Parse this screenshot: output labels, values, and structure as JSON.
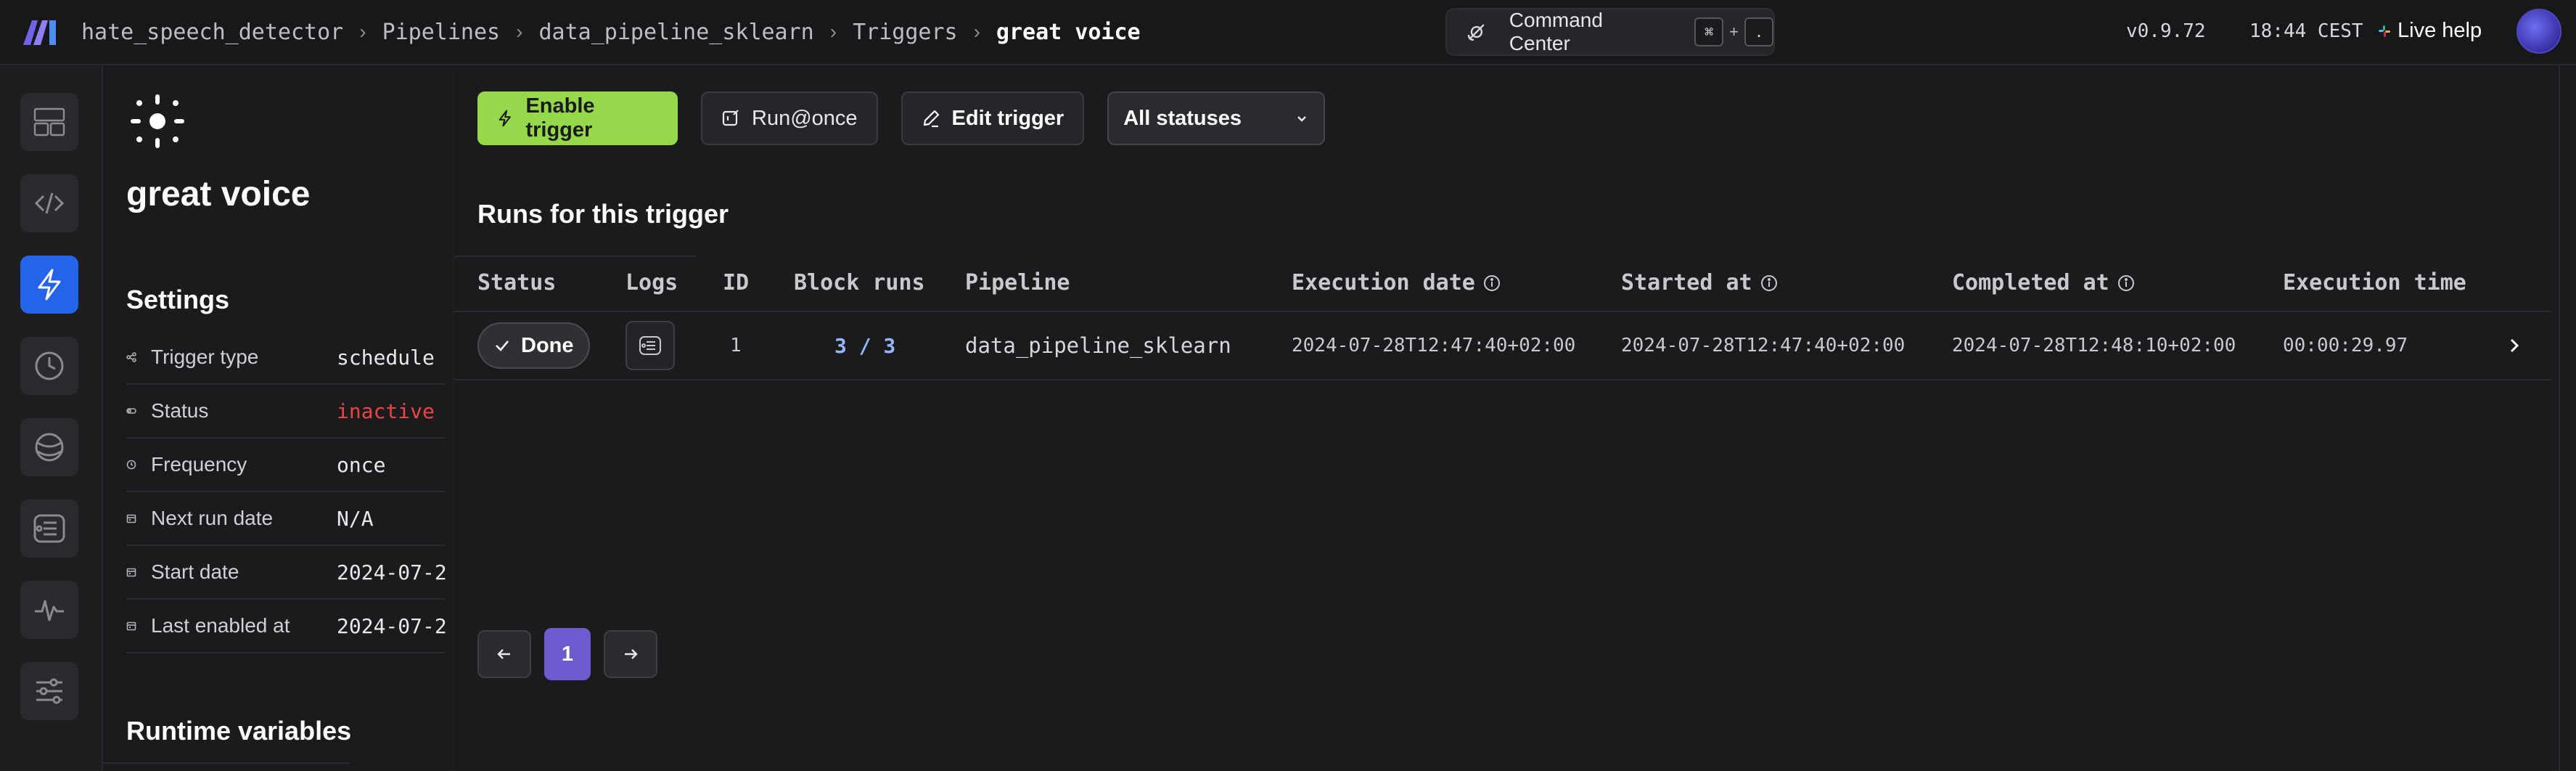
{
  "header": {
    "breadcrumb": [
      "hate_speech_detector",
      "Pipelines",
      "data_pipeline_sklearn",
      "Triggers",
      "great voice"
    ],
    "command_center": {
      "label": "Command Center",
      "key1": "⌘",
      "plus": "+",
      "key2": "."
    },
    "version": "v0.9.72",
    "time": "18:44 CEST",
    "live_help": "Live help"
  },
  "sidebar": {
    "items": [
      {
        "icon": "overview-icon",
        "active": false
      },
      {
        "icon": "code-icon",
        "active": false
      },
      {
        "icon": "trigger-icon",
        "active": true
      },
      {
        "icon": "clock-icon",
        "active": false
      },
      {
        "icon": "backfill-icon",
        "active": false
      },
      {
        "icon": "logs-icon",
        "active": false
      },
      {
        "icon": "monitor-icon",
        "active": false
      },
      {
        "icon": "settings-icon",
        "active": false
      }
    ]
  },
  "trigger": {
    "name": "great voice",
    "settings_heading": "Settings",
    "settings": [
      {
        "label": "Trigger type",
        "value": "schedule",
        "icon": "share-icon"
      },
      {
        "label": "Status",
        "value": "inactive",
        "icon": "toggle-icon",
        "danger": true
      },
      {
        "label": "Frequency",
        "value": "once",
        "icon": "clock-icon"
      },
      {
        "label": "Next run date",
        "value": "N/A",
        "icon": "calendar-icon"
      },
      {
        "label": "Start date",
        "value": "2024-07-2",
        "icon": "calendar-icon"
      },
      {
        "label": "Last enabled at",
        "value": "2024-07-2",
        "icon": "calendar-icon"
      }
    ],
    "runtime_heading": "Runtime variables"
  },
  "toolbar": {
    "enable_label": "Enable trigger",
    "run_once_label": "Run@once",
    "edit_label": "Edit trigger",
    "status_filter": "All statuses"
  },
  "runs": {
    "heading": "Runs for this trigger",
    "columns": [
      "Status",
      "Logs",
      "ID",
      "Block runs",
      "Pipeline",
      "Execution date",
      "Started at",
      "Completed at",
      "Execution time"
    ],
    "rows": [
      {
        "status": "Done",
        "id": "1",
        "block_runs": "3 / 3",
        "pipeline": "data_pipeline_sklearn",
        "execution_date": "2024-07-28T12:47:40+02:00",
        "started_at": "2024-07-28T12:47:40+02:00",
        "completed_at": "2024-07-28T12:48:10+02:00",
        "execution_time": "00:00:29.97"
      }
    ]
  },
  "pagination": {
    "current_page": "1"
  },
  "colors": {
    "accent": "#95d94a",
    "active_nav": "#2563eb",
    "page_active": "#6d5bd0",
    "danger": "#ef4444"
  }
}
